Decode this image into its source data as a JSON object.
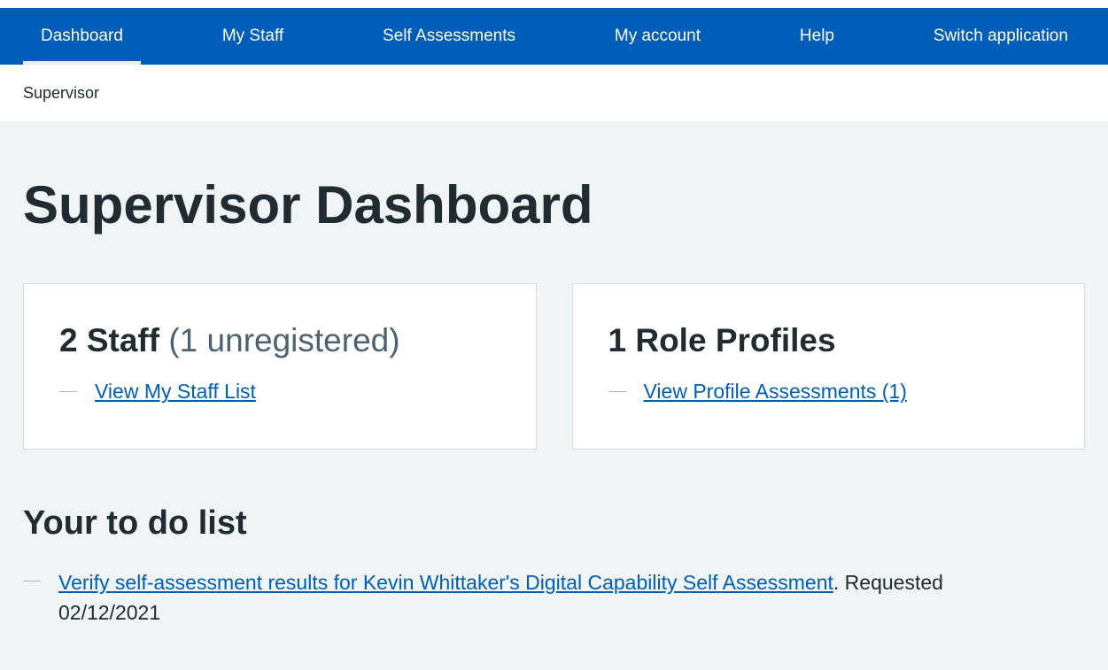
{
  "nav": {
    "items": [
      {
        "label": "Dashboard",
        "active": true
      },
      {
        "label": "My Staff"
      },
      {
        "label": "Self Assessments"
      },
      {
        "label": "My account"
      },
      {
        "label": "Help"
      },
      {
        "label": "Switch application"
      }
    ]
  },
  "breadcrumb": "Supervisor",
  "page_title": "Supervisor Dashboard",
  "cards": {
    "staff": {
      "count_label": "2 Staff",
      "unregistered": "(1 unregistered)",
      "link": "View My Staff List"
    },
    "profiles": {
      "title": "1 Role Profiles",
      "link": "View Profile Assessments (1)"
    }
  },
  "todo": {
    "title": "Your to do list",
    "items": [
      {
        "link": "Verify self-assessment results for Kevin Whittaker's Digital Capability Self Assessment",
        "suffix": ". Requested 02/12/2021"
      }
    ]
  },
  "colors": {
    "nav_bg": "#005eb8",
    "page_bg": "#f0f4f5",
    "link": "#005eb8",
    "text": "#212b32"
  }
}
